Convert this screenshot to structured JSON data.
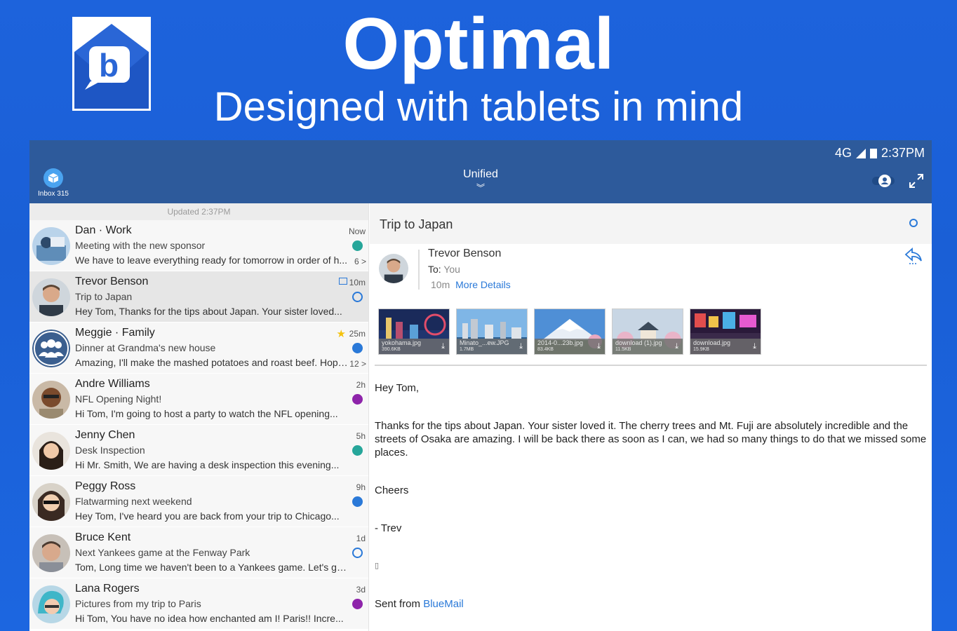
{
  "promo": {
    "title": "Optimal",
    "subtitle": "Designed with tablets in mind"
  },
  "colors": {
    "background": "#1d63dc",
    "app_bar": "#2d5a9b",
    "accent": "#2a79d8"
  },
  "status_bar": {
    "network": "4G",
    "time": "2:37PM"
  },
  "app_bar": {
    "inbox_label": "Inbox 315",
    "account_selector": "Unified"
  },
  "list": {
    "updated": "Updated 2:37PM",
    "rows": [
      {
        "name": "Dan · Work",
        "subject": "Meeting with the new sponsor",
        "preview": "We have to leave everything ready for tomorrow in order of h...",
        "time": "Now",
        "count": "6 >",
        "dot": "#26a69a"
      },
      {
        "name": "Trevor Benson",
        "subject": "Trip to Japan",
        "preview": "Hey Tom, Thanks for the tips about Japan. Your sister loved...",
        "time": "10m",
        "count": "",
        "dot": "ring"
      },
      {
        "name": "Meggie · Family",
        "subject": "Dinner at Grandma's new house",
        "preview": "Amazing, I'll make the mashed potatoes and roast beef. Hope...",
        "time": "25m",
        "count": "12 >",
        "dot": "#2a79d8"
      },
      {
        "name": "Andre Williams",
        "subject": "NFL Opening Night!",
        "preview": "Hi Tom, I'm going to host a party to watch the NFL opening...",
        "time": "2h",
        "count": "",
        "dot": "#8e24aa"
      },
      {
        "name": "Jenny Chen",
        "subject": "Desk Inspection",
        "preview": "Hi Mr. Smith, We are having a desk inspection this evening...",
        "time": "5h",
        "count": "",
        "dot": "#26a69a"
      },
      {
        "name": "Peggy Ross",
        "subject": "Flatwarming next weekend",
        "preview": "Hey Tom, I've heard you are back from your trip to Chicago...",
        "time": "9h",
        "count": "",
        "dot": "#2a79d8"
      },
      {
        "name": "Bruce Kent",
        "subject": "Next Yankees game at the Fenway Park",
        "preview": "Tom, Long time we haven't been to a Yankees game. Let's go...",
        "time": "1d",
        "count": "",
        "dot": "ring"
      },
      {
        "name": "Lana Rogers",
        "subject": "Pictures from my trip to Paris",
        "preview": "Hi Tom, You have no idea how enchanted am I! Paris!! Incre...",
        "time": "3d",
        "count": "",
        "dot": "#8e24aa"
      }
    ]
  },
  "reader": {
    "subject": "Trip to Japan",
    "sender": "Trevor Benson",
    "to_label": "To:",
    "to_value": "You",
    "age": "10m",
    "more_details": "More Details",
    "attachments": [
      {
        "name": "yokohama.jpg",
        "size": "390.6KB"
      },
      {
        "name": "Minato_...ew.JPG",
        "size": "1.7MB"
      },
      {
        "name": "2014-0...23b.jpg",
        "size": "83.4KB"
      },
      {
        "name": "download (1).jpg",
        "size": "11.5KB"
      },
      {
        "name": "download.jpg",
        "size": "15.9KB"
      }
    ],
    "body": {
      "greeting": "Hey Tom,",
      "paragraph": "Thanks for the tips about Japan. Your sister loved it. The cherry trees and Mt. Fuji are absolutely incredible and the streets of Osaka are amazing. I will be back there as soon as I can, we had so many things to do that we missed some places.",
      "closing": "Cheers",
      "signature": "- Trev",
      "glyph": "▯",
      "sent_from": "Sent from ",
      "sent_link": "BlueMail"
    }
  }
}
